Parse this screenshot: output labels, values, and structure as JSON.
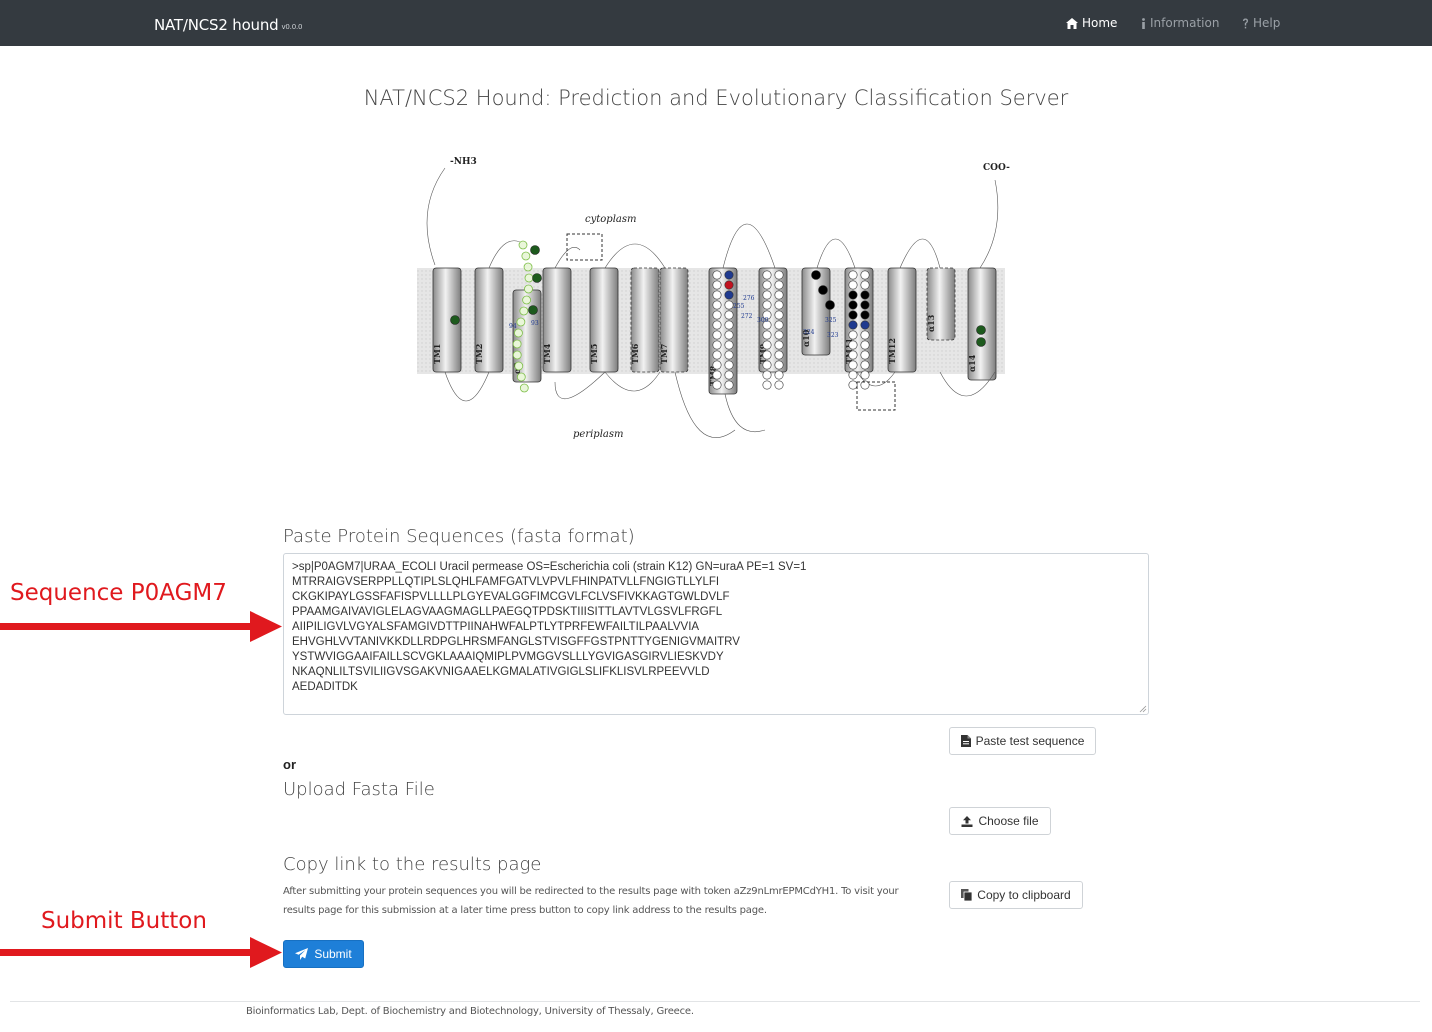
{
  "navbar": {
    "brand": "NAT/NCS2 hound",
    "version": "v0.0.0",
    "links": [
      {
        "label": "Home",
        "icon": "home-icon"
      },
      {
        "label": "Information",
        "icon": "info-icon"
      },
      {
        "label": "Help",
        "icon": "help-icon"
      }
    ]
  },
  "page_title": "NAT/NCS2 Hound: Prediction and Evolutionary Classification Server",
  "figure": {
    "nh3": "-NH3",
    "coo": "COO-",
    "cytoplasm": "cytoplasm",
    "periplasm": "periplasm",
    "tm_labels": [
      "TM1",
      "TM2",
      "α3",
      "TM4",
      "TM5",
      "TM6",
      "TM7",
      "TM8",
      "TM9",
      "α10",
      "TM11",
      "TM12",
      "α13",
      "α14"
    ],
    "residue_labels": [
      "276",
      "255",
      "272",
      "300",
      "325",
      "324",
      "323",
      "94",
      "93"
    ]
  },
  "paste_section": {
    "heading": "Paste Protein Sequences (fasta format)",
    "sequence": ">sp|P0AGM7|URAA_ECOLI Uracil permease OS=Escherichia coli (strain K12) GN=uraA PE=1 SV=1\nMTRRAIGVSERPPLLQTIPLSLQHLFAMFGATVLVPVLFHINPATVLLFNGIGTLLYLFI\nCKGKIPAYLGSSFAFISPVLLLLPLGYEVALGGFIMCGVLFCLVSFIVKKAGTGWLDVLF\nPPAAMGAIVAVIGLELAGVAAGMAGLLPAEGQTPDSKTIIISITTLAVTVLGSVLFRGFL\nAIIPILIGVLVGYALSFAMGIVDTTPIINAHWFALPTLYTPRFEWFAILTILPAALVVIA\nEHVGHLVVTANIVKKDLLRDPGLHRSMFANGLSTVISGFFGSTPNTTYGENIGVMAITRV\nYSTWVIGGAAIFAILLSCVGKLAAAIQMIPLPVMGGVSLLLYGVIGASGIRVLIESKVDY\nNKAQNLILTSVILIIGVSGAKVNIGAAELKGMALATIVGIGLSLIFKLISVLRPEEVVLD\nAEDADITDK",
    "paste_test_button": "Paste test sequence"
  },
  "or_label": "or",
  "upload_section": {
    "heading": "Upload Fasta File",
    "choose_button": "Choose file"
  },
  "copy_section": {
    "heading": "Copy link to the results page",
    "description": "After submitting your protein sequences you will be redirected to the results page with token aZz9nLmrEPMCdYH1. To visit your results page for this submission at a later time press button to copy link address to the results page.",
    "copy_button": "Copy to clipboard"
  },
  "submit_button": "Submit",
  "annotations": {
    "sequence_label": "Sequence P0AGM7",
    "submit_label": "Submit Button",
    "color": "#e0191e"
  },
  "footer": "Bioinformatics Lab, Dept. of Biochemistry and Biotechnology, University of Thessaly, Greece."
}
